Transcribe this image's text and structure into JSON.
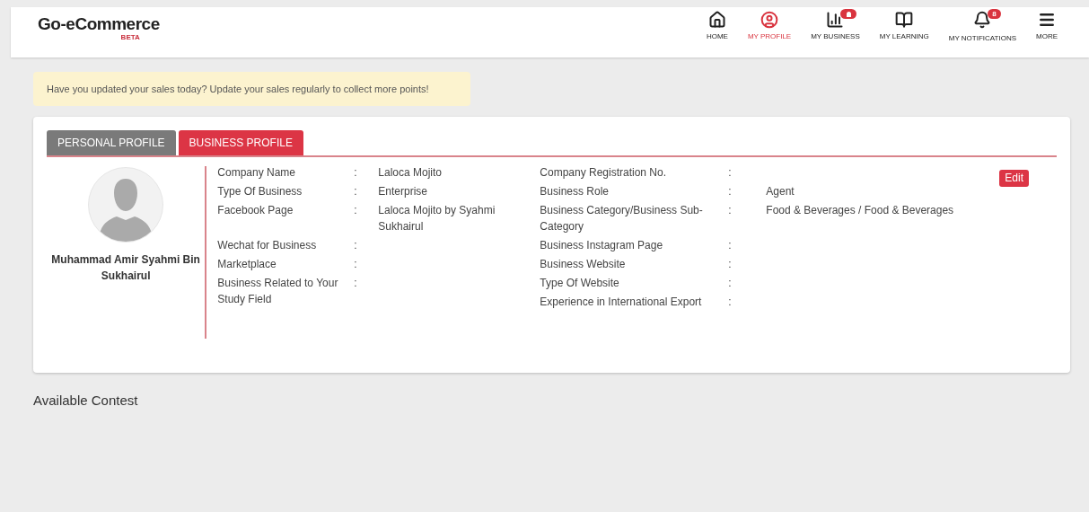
{
  "header": {
    "logo": "Go-eCommerce",
    "logo_tag": "BETA",
    "nav": [
      {
        "kind": "home",
        "label": "HOME",
        "selected": false
      },
      {
        "kind": "profile",
        "label": "MY PROFILE",
        "selected": true
      },
      {
        "kind": "business",
        "label": "MY BUSINESS",
        "selected": false,
        "alert": true
      },
      {
        "kind": "learning",
        "label": "MY LEARNING",
        "selected": false
      },
      {
        "kind": "notifications",
        "label": "MY NOTIFICATIONS",
        "selected": false,
        "badge": "8"
      },
      {
        "kind": "more",
        "label": "MORE",
        "selected": false
      }
    ]
  },
  "notice": "Have you updated your sales today? Update your sales regularly to collect more points!",
  "tabs": [
    {
      "label": "PERSONAL PROFILE",
      "selected": false
    },
    {
      "label": "BUSINESS PROFILE",
      "selected": true
    }
  ],
  "profile": {
    "name": "Muhammad Amir Syahmi Bin Sukhairul",
    "edit_button": "Edit",
    "left_fields": [
      {
        "label": "Company Name",
        "separator": ":",
        "value": "Laloca Mojito"
      },
      {
        "label": "Type Of Business",
        "separator": ":",
        "value": "Enterprise"
      },
      {
        "label": "Facebook Page",
        "separator": ":",
        "value": "Laloca Mojito by Syahmi Sukhairul"
      },
      {
        "label": "Wechat for Business",
        "separator": ":"
      },
      {
        "label": "Marketplace",
        "separator": ":"
      },
      {
        "label": "Business Related to Your Study Field",
        "separator": ":"
      }
    ],
    "right_fields": [
      {
        "label": "Company Registration No.",
        "separator": ":"
      },
      {
        "label": "Business Role",
        "separator": ":",
        "value": "Agent"
      },
      {
        "label": "Business Category/Business Sub-Category",
        "separator": ":",
        "value": "Food & Beverages / Food & Beverages"
      },
      {
        "label": "Business Instagram Page",
        "separator": ":"
      },
      {
        "label": "Business Website",
        "separator": ":"
      },
      {
        "label": "Type Of Website",
        "separator": ":"
      },
      {
        "label": "Experience in International Export",
        "separator": ":"
      }
    ]
  },
  "section_title": "Available Contest"
}
